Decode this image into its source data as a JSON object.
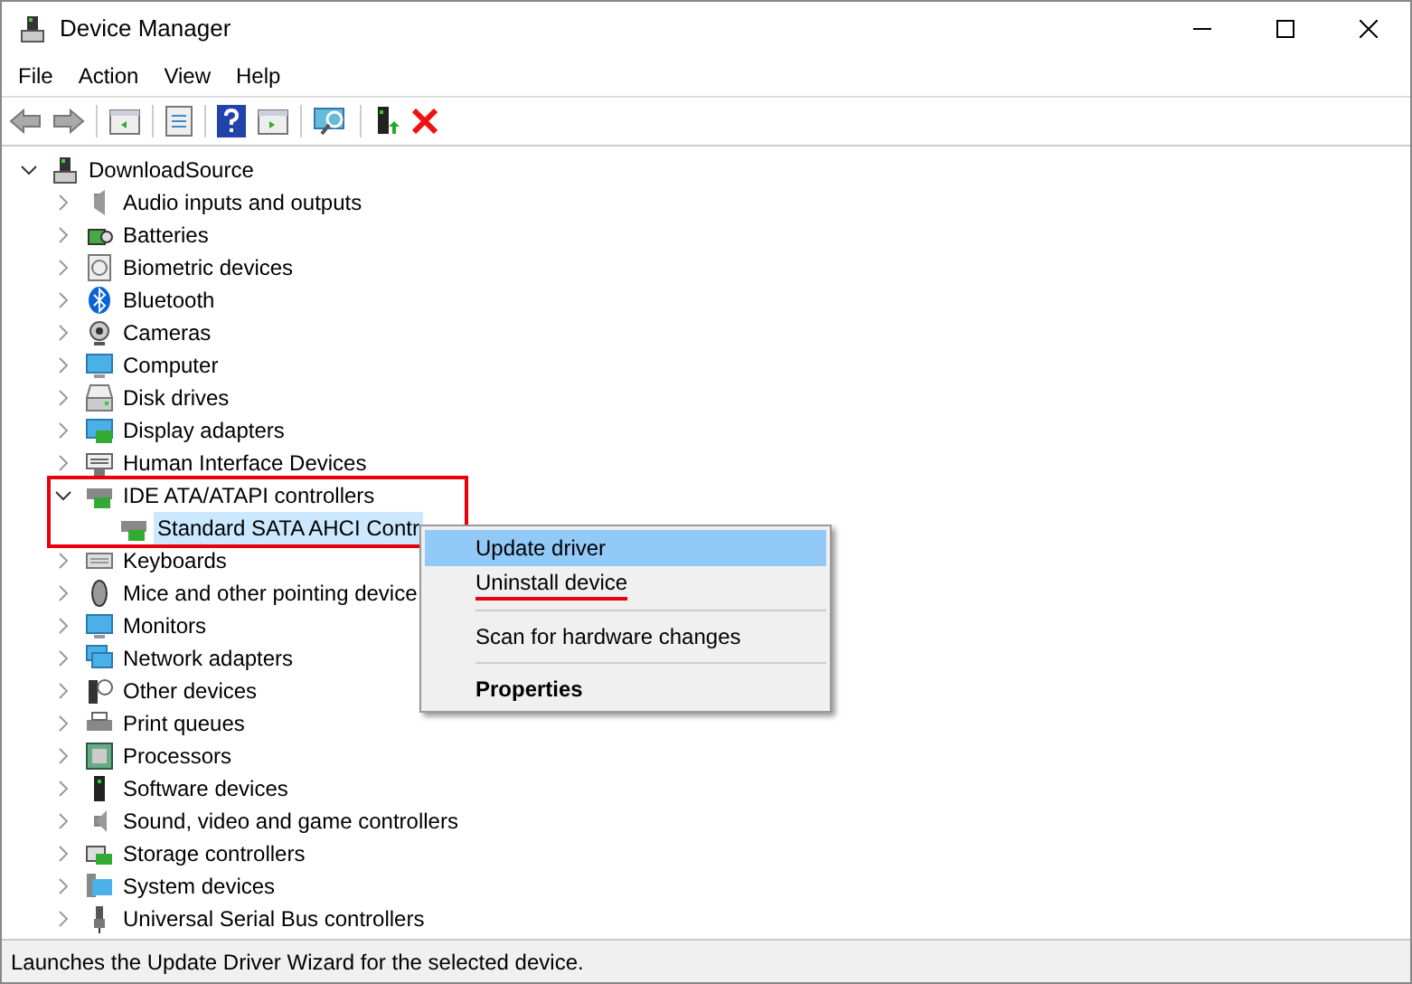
{
  "window": {
    "title": "Device Manager"
  },
  "menu": [
    "File",
    "Action",
    "View",
    "Help"
  ],
  "tree": {
    "label": "DownloadSource",
    "expanded": true,
    "children": [
      {
        "label": "Audio inputs and outputs",
        "expanded": false
      },
      {
        "label": "Batteries",
        "expanded": false
      },
      {
        "label": "Biometric devices",
        "expanded": false
      },
      {
        "label": "Bluetooth",
        "expanded": false
      },
      {
        "label": "Cameras",
        "expanded": false
      },
      {
        "label": "Computer",
        "expanded": false
      },
      {
        "label": "Disk drives",
        "expanded": false
      },
      {
        "label": "Display adapters",
        "expanded": false
      },
      {
        "label": "Human Interface Devices",
        "expanded": false
      },
      {
        "label": "IDE ATA/ATAPI controllers",
        "expanded": true,
        "annotated": true,
        "children": [
          {
            "label": "Standard SATA AHCI Contr",
            "selected": true
          }
        ]
      },
      {
        "label": "Keyboards",
        "expanded": false
      },
      {
        "label": "Mice and other pointing device",
        "expanded": false
      },
      {
        "label": "Monitors",
        "expanded": false
      },
      {
        "label": "Network adapters",
        "expanded": false
      },
      {
        "label": "Other devices",
        "expanded": false
      },
      {
        "label": "Print queues",
        "expanded": false
      },
      {
        "label": "Processors",
        "expanded": false
      },
      {
        "label": "Software devices",
        "expanded": false
      },
      {
        "label": "Sound, video and game controllers",
        "expanded": false
      },
      {
        "label": "Storage controllers",
        "expanded": false
      },
      {
        "label": "System devices",
        "expanded": false
      },
      {
        "label": "Universal Serial Bus controllers",
        "expanded": false
      }
    ]
  },
  "context_menu": [
    {
      "label": "Update driver",
      "selected": true,
      "annotated": false,
      "bold": false
    },
    {
      "label": "Uninstall device",
      "selected": false,
      "annotated": true,
      "bold": false
    },
    {
      "label": "Scan for hardware changes",
      "selected": false,
      "annotated": false,
      "bold": false
    },
    {
      "label": "Properties",
      "selected": false,
      "annotated": false,
      "bold": true
    }
  ],
  "status_bar": "Launches the Update Driver Wizard for the selected device."
}
